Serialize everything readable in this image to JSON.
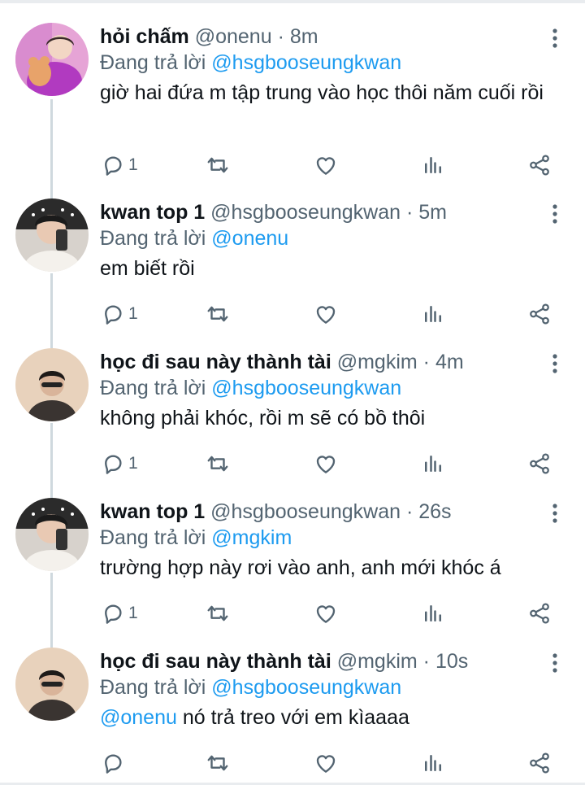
{
  "tweets": [
    {
      "name": "hỏi chấm",
      "handle": "@onenu",
      "dot": "·",
      "time": "8m",
      "reply_prefix": "Đang trả lời",
      "reply_to": "@hsgbooseungkwan",
      "text": "giờ hai đứa m tập trung vào học thôi năm cuối rồi",
      "reply_count": "1",
      "avatar": "pink-hair-avatar"
    },
    {
      "name": "kwan top 1",
      "handle": "@hsgbooseungkwan",
      "dot": "·",
      "time": "5m",
      "reply_prefix": "Đang trả lời",
      "reply_to": "@onenu",
      "text": "em biết rồi",
      "reply_count": "1",
      "avatar": "mirror-selfie-avatar"
    },
    {
      "name": "học đi sau này thành tài",
      "handle": "@mgkim",
      "dot": "·",
      "time": "4m",
      "reply_prefix": "Đang trả lời",
      "reply_to": "@hsgbooseungkwan",
      "text": "không phải khóc, rồi m sẽ có bồ thôi",
      "reply_count": "1",
      "avatar": "beige-photo-avatar"
    },
    {
      "name": "kwan top 1",
      "handle": "@hsgbooseungkwan",
      "dot": "·",
      "time": "26s",
      "reply_prefix": "Đang trả lời",
      "reply_to": "@mgkim",
      "text": "trường hợp này rơi vào anh, anh mới khóc á",
      "reply_count": "1",
      "avatar": "mirror-selfie-avatar"
    },
    {
      "name": "học đi sau này thành tài",
      "handle": "@mgkim",
      "dot": "·",
      "time": "10s",
      "reply_prefix": "Đang trả lời",
      "reply_to": "@hsgbooseungkwan",
      "text_mention": "@onenu",
      "text": " nó trả treo với em kìaaaa",
      "reply_count": "",
      "avatar": "beige-photo-avatar"
    }
  ],
  "icons": {
    "reply": "reply-icon",
    "retweet": "retweet-icon",
    "like": "heart-icon",
    "views": "views-icon",
    "share": "share-icon",
    "more": "more-icon"
  },
  "colors": {
    "mention": "#1d9bf0",
    "secondary_text": "#536471",
    "thread_line": "#cfd9de"
  }
}
